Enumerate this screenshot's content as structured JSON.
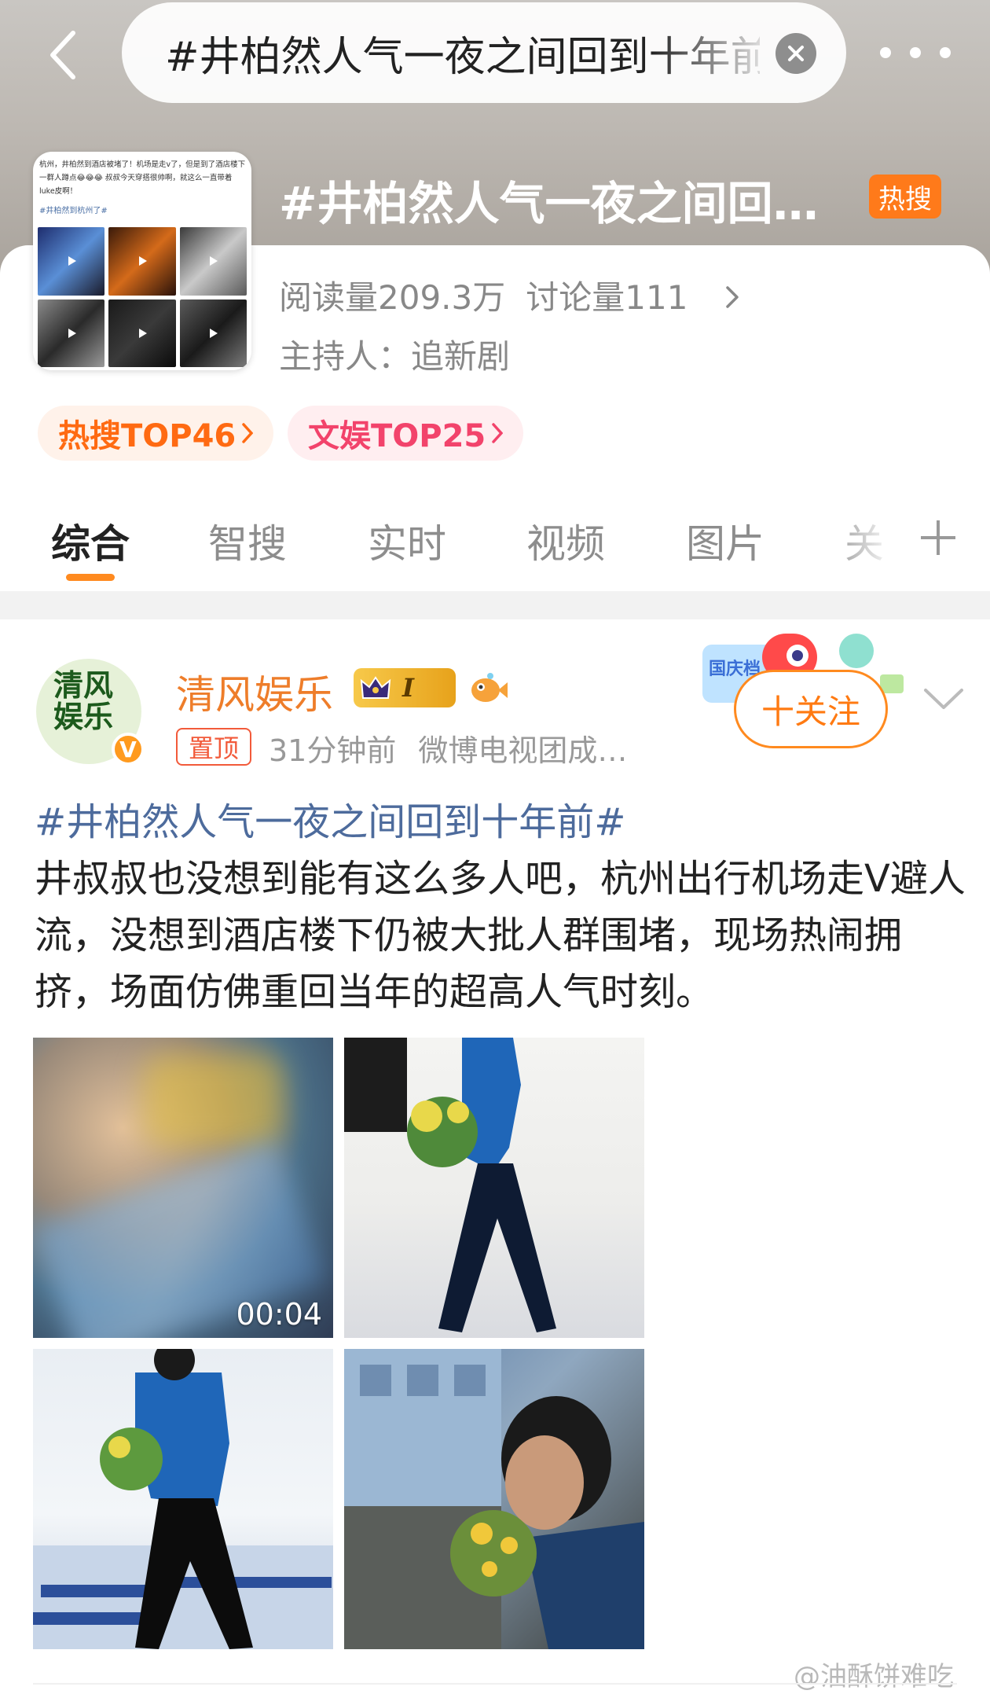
{
  "search": {
    "query": "#井柏然人气一夜之间回到十年前#"
  },
  "topic": {
    "title": "#井柏然人气一夜之间回到十年前#",
    "hot_badge": "热搜",
    "reads": "阅读量209.3万",
    "discussions": "讨论量111",
    "host": "主持人：追新剧",
    "thumbnail_text": "杭州，井柏然到酒店被堵了！机场是走v了，但是到了酒店楼下一群人蹲点😂😂😂 叔叔今天穿搭很帅啊，就这么一直带着luke皮啊！",
    "thumbnail_tag": "#井柏然到杭州了#",
    "rankings": [
      {
        "label": "热搜TOP46"
      },
      {
        "label": "文娱TOP25"
      }
    ]
  },
  "tabs": [
    {
      "label": "综合",
      "active": true
    },
    {
      "label": "智搜"
    },
    {
      "label": "实时"
    },
    {
      "label": "视频"
    },
    {
      "label": "图片"
    },
    {
      "label": "关"
    }
  ],
  "post": {
    "author": "清风娱乐",
    "avatar_text": "清风娱乐",
    "level": "I",
    "pin_label": "置顶",
    "time": "31分钟前",
    "source": "微博电视团成…",
    "follow_label": "十关注",
    "decor_text": "国庆档影评",
    "hashtag": "#井柏然人气一夜之间回到十年前#",
    "body": "井叔叔也没想到能有这么多人吧，杭州出行机场走V避人流，没想到酒店楼下仍被大批人群围堵，现场热闹拥挤，场面仿佛重回当年的超高人气时刻。",
    "video_duration": "00:04",
    "image_count": 4
  },
  "watermark": "@油酥饼难吃",
  "colors": {
    "accent_orange": "#ff8a1f",
    "hashtag_blue": "#4d6b9c",
    "hot_red": "#f2436b"
  }
}
